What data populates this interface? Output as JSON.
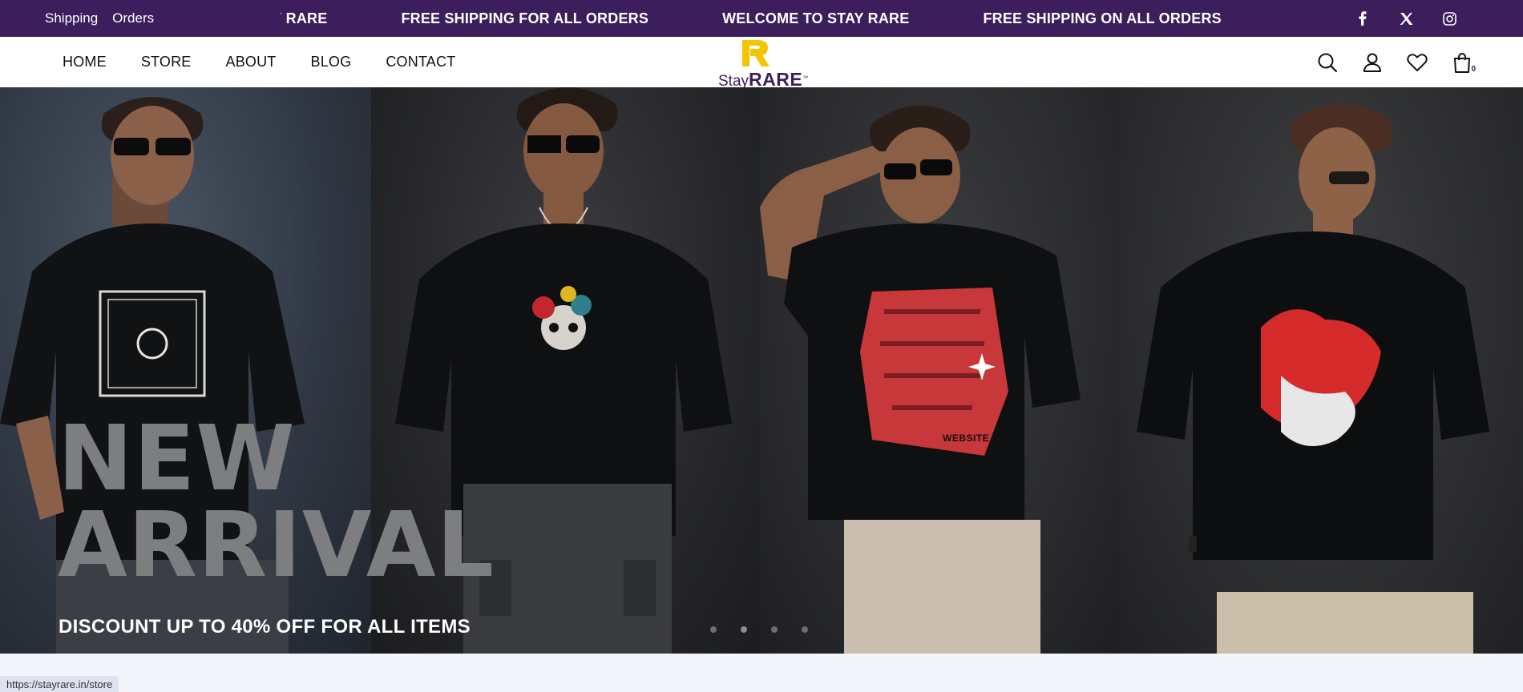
{
  "topbar": {
    "links": [
      "Shipping",
      "Orders"
    ],
    "marquee": [
      "AY RARE",
      "FREE SHIPPING FOR ALL ORDERS",
      "WELCOME TO STAY RARE",
      "FREE SHIPPING ON ALL ORDERS"
    ],
    "socials": [
      "facebook-icon",
      "x-icon",
      "instagram-icon"
    ]
  },
  "header": {
    "nav": [
      "HOME",
      "STORE",
      "ABOUT",
      "BLOG",
      "CONTACT"
    ],
    "logo": {
      "stay": "Stay",
      "rare": "RARE",
      "tm": "™"
    },
    "icons": [
      "search-icon",
      "user-icon",
      "heart-icon",
      "bag-icon"
    ],
    "cart_count": "0"
  },
  "hero": {
    "title_line1": "NEW",
    "title_line2": "ARRIVAL",
    "subtitle": "DISCOUNT UP TO 40% OFF FOR ALL ITEMS",
    "overlay_text": "WEBSITE",
    "slide_count": 4,
    "active_slide": 2
  },
  "status": {
    "url": "https://stayrare.in/store"
  },
  "colors": {
    "brand_purple": "#3c1e5c",
    "brand_yellow": "#f5c400",
    "hero_text_gray": "#7d7e80"
  }
}
